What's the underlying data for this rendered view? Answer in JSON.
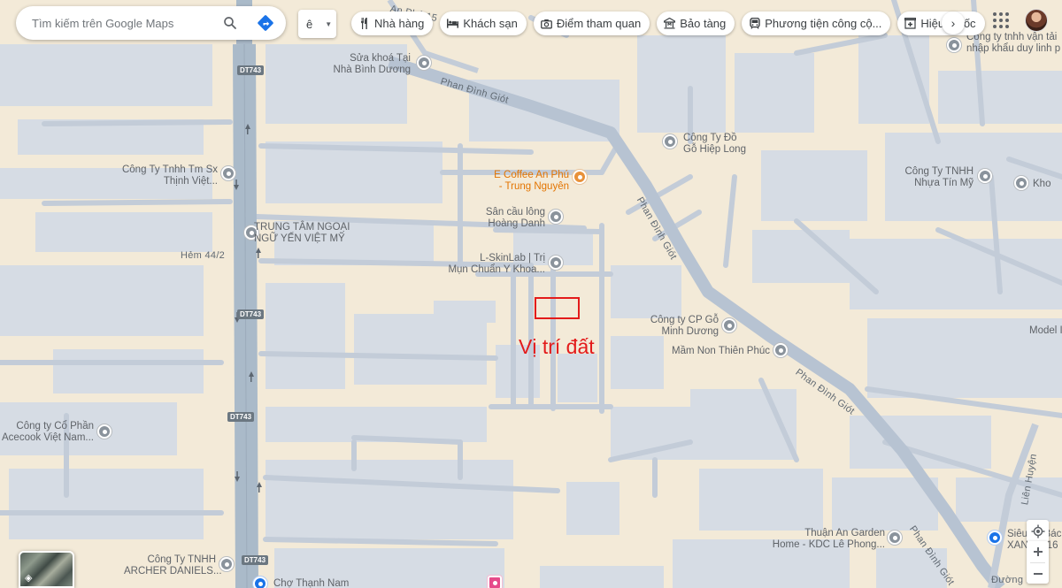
{
  "search": {
    "placeholder": "Tìm kiếm trên Google Maps"
  },
  "layer_toggle": {
    "label": "ê"
  },
  "chips": [
    {
      "icon": "restaurant-icon",
      "label": "Nhà hàng"
    },
    {
      "icon": "hotel-icon",
      "label": "Khách sạn"
    },
    {
      "icon": "camera-icon",
      "label": "Điểm tham quan"
    },
    {
      "icon": "museum-icon",
      "label": "Bảo tàng"
    },
    {
      "icon": "transit-icon",
      "label": "Phương tiện công cộ..."
    },
    {
      "icon": "pharmacy-icon",
      "label": "Hiệu thuốc"
    }
  ],
  "annotation": {
    "label": "Vị trí đất",
    "color": "#e31b1b"
  },
  "road_shields": [
    "DT743",
    "DT743",
    "DT743",
    "DT743"
  ],
  "streets": {
    "phan_dinh_giot_1": "Phan Đình Giót",
    "phan_dinh_giot_2": "Phan Đình Giót",
    "phan_dinh_giot_3": "Phan Đình Giót",
    "phan_dinh_giot_4": "Phan Đình Giót",
    "hem": "Hẻm 44/2",
    "an_phu": "An Phú 15",
    "lien_huyen": "Liên Huyện",
    "duong": "Đường 1..."
  },
  "places": {
    "sua_khoa": [
      "Sửa khoá Tại",
      "Nhà Bình Dương"
    ],
    "cty_tnhh_tm": [
      "Công Ty Tnhh Tm Sx",
      "Thịnh Việt..."
    ],
    "trung_tam": [
      "TRUNG TÂM NGOẠI",
      "NGỮ YẾN VIỆT MỸ"
    ],
    "e_coffee": [
      "E Coffee An Phú",
      "- Trung Nguyên"
    ],
    "san_cau_long": [
      "Sân cầu lông",
      "Hoàng Danh"
    ],
    "l_skinlab": [
      "L-SkinLab | Trị",
      "Mụn Chuẩn Y Khoa..."
    ],
    "cty_do_go": [
      "Công Ty Đồ",
      "Gỗ Hiệp Long"
    ],
    "cty_van_tai": [
      "Công ty tnhh vận tải",
      "nhập khẩu duy linh p"
    ],
    "cty_nhua": [
      "Công Ty TNHH",
      "Nhựa Tín Mỹ"
    ],
    "kho": [
      "Kho"
    ],
    "cty_cp_go": [
      "Công ty CP Gỗ",
      "Minh Dương"
    ],
    "mam_non": [
      "Mầm Non Thiên Phúc"
    ],
    "model": [
      "Model I"
    ],
    "acecook": [
      "Công ty Cổ Phần",
      "Acecook Việt Nam..."
    ],
    "thuan_an": [
      "Thuận An Garden",
      "Home - KDC Lê Phong..."
    ],
    "archer": [
      "Công Ty TNHH",
      "ARCHER DANIELS..."
    ],
    "cho": [
      "Chợ Thạnh Nam"
    ],
    "sieu_thi": [
      "Siêu thị Bác",
      "XANH 1/16"
    ]
  }
}
